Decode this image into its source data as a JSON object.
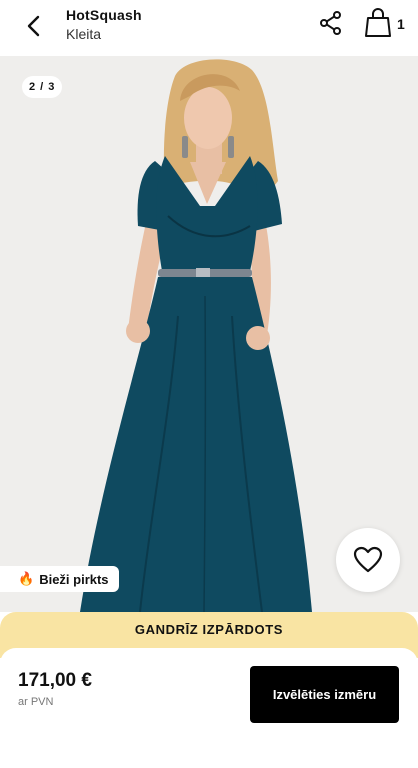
{
  "header": {
    "brand": "HotSquash",
    "subtitle": "Kleita",
    "back_icon": "chevron-left-icon",
    "share_icon": "share-icon",
    "bag_icon": "shopping-bag-icon",
    "bag_count": "1"
  },
  "gallery": {
    "counter": "2 / 3",
    "image_alt": "Woman wearing a long dark teal wrap maxi dress with a silver belt",
    "dress_color": "#0f4a60",
    "background_color": "#efeeec"
  },
  "favorite": {
    "icon": "heart-icon"
  },
  "badge": {
    "icon": "fire-icon",
    "text": "Bieži pirkts"
  },
  "stock_strip": {
    "text": "GANDRĪZ IZPĀRDOTS",
    "color": "#f9e4a3"
  },
  "purchase": {
    "price": "171,00 €",
    "vat_note": "ar PVN",
    "select_size_label": "Izvēlēties izmēru"
  }
}
